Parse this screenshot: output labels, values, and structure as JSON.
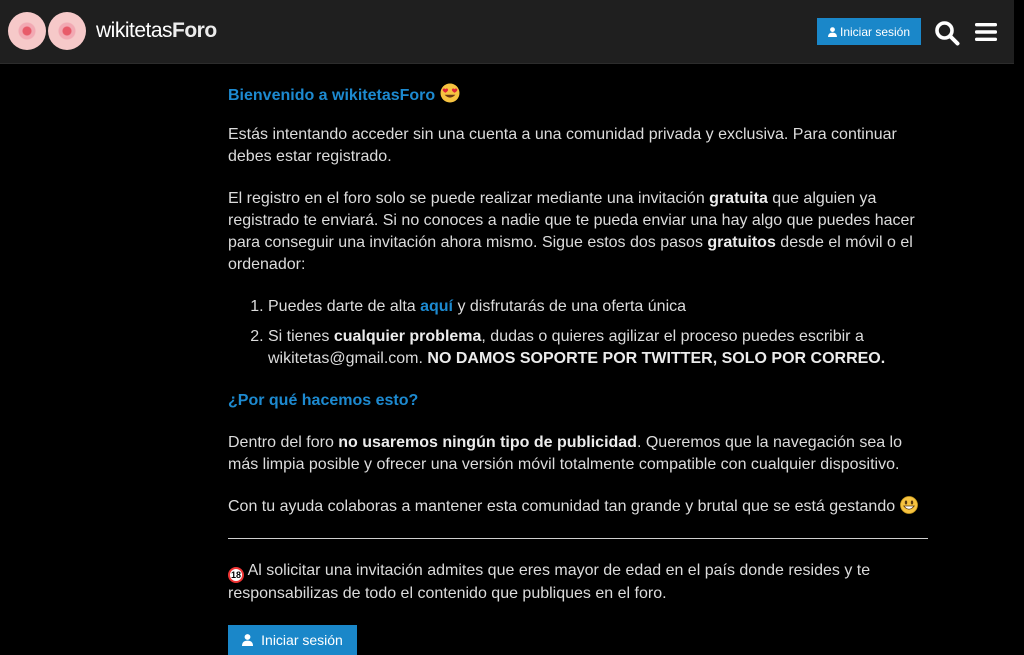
{
  "header": {
    "logo_prefix": "wikitetas",
    "logo_suffix": "Foro",
    "login_label": "Iniciar sesión",
    "colors": {
      "bar": "#1f1f1f",
      "accent": "#1a87c9"
    }
  },
  "main": {
    "welcome_title": "Bienvenido a wikitetasForo",
    "intro": "Estás intentando acceder sin una cuenta a una comunidad privada y exclusiva. Para continuar debes estar registrado.",
    "registro": {
      "t1": "El registro en el foro solo se puede realizar mediante una invitación ",
      "b1": "gratuita",
      "t2": " que alguien ya registrado te enviará. Si no conoces a nadie que te pueda enviar una hay algo que puedes hacer para conseguir una invitación ahora mismo. Sigue estos dos pasos ",
      "b2": "gratuitos",
      "t3": " desde el móvil o el ordenador:"
    },
    "steps": {
      "s1_a": "Puedes darte de alta ",
      "s1_link": "aquí",
      "s1_b": " y disfrutarás de una oferta única",
      "s2_a": "Si tienes ",
      "s2_bold": "cualquier problema",
      "s2_b": ", dudas o quieres agilizar el proceso puedes escribir a wikitetas@gmail.com. ",
      "s2_bold2": "NO DAMOS SOPORTE POR TWITTER, SOLO POR CORREO."
    },
    "why_title": "¿Por qué hacemos esto?",
    "why": {
      "t1": "Dentro del foro ",
      "b1": "no usaremos ningún tipo de publicidad",
      "t2": ". Queremos que la navegación sea lo más limpia posible y ofrecer una versión móvil totalmente compatible con cualquier dispositivo."
    },
    "help": "Con tu ayuda colaboras a mantener esta comunidad tan grande y brutal que se está gestando",
    "age_badge": "18",
    "age_notice": "Al solicitar una invitación admites que eres mayor de edad en el país donde resides y te responsabilizas de todo el contenido que publiques en el foro.",
    "login_label": "Iniciar sesión"
  },
  "icons": [
    "user-icon",
    "search-icon",
    "menu-icon",
    "heart-eyes-emoji-icon",
    "grin-emoji-icon",
    "no-under-18-icon"
  ]
}
